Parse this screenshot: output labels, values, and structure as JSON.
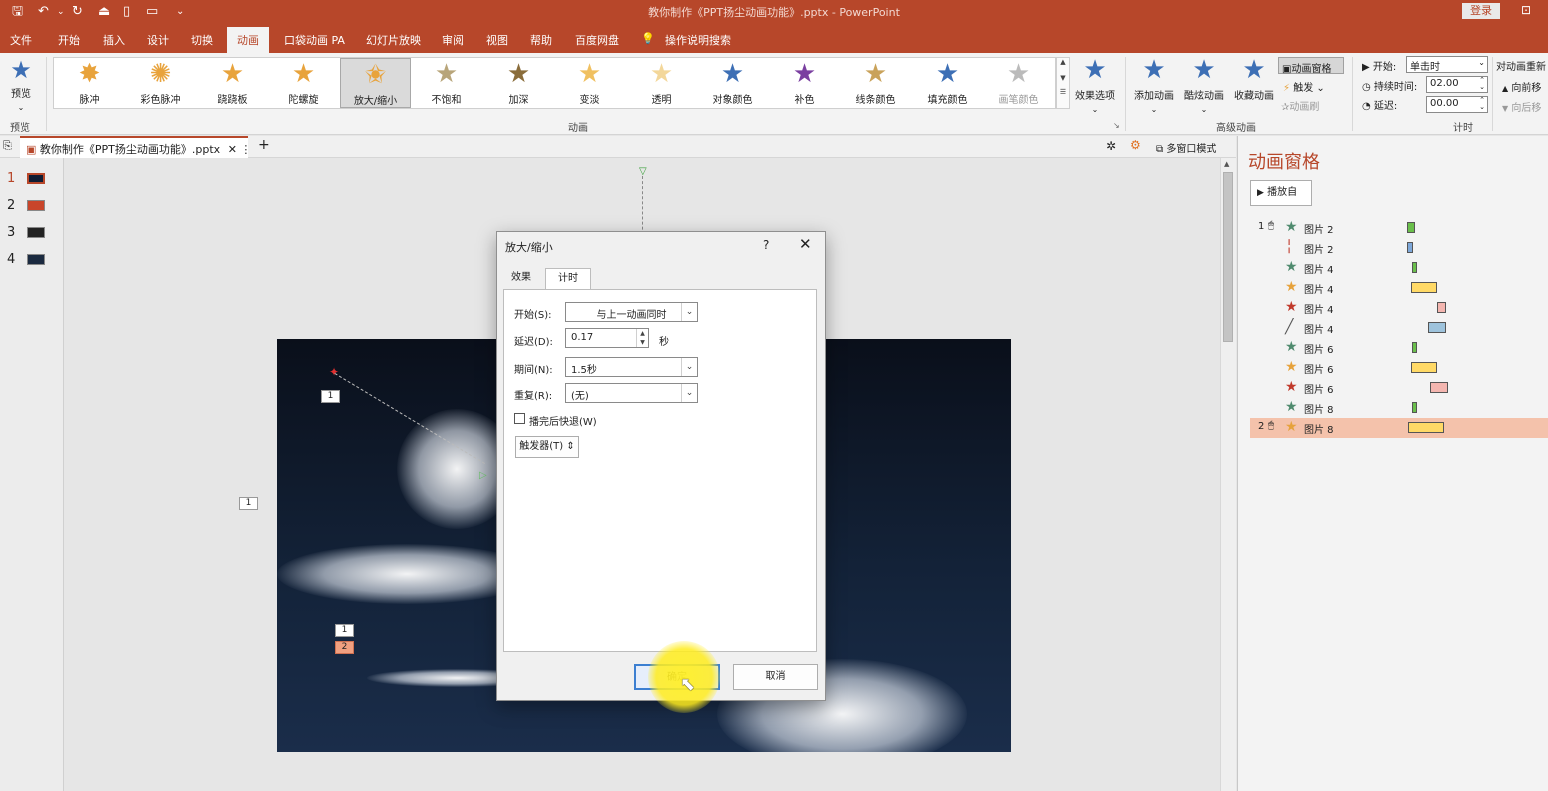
{
  "title_bar": {
    "title": "教你制作《PPT扬尘动画功能》.pptx  -  PowerPoint",
    "login": "登录"
  },
  "menu": [
    "文件",
    "开始",
    "插入",
    "设计",
    "切换",
    "动画",
    "口袋动画 PA",
    "幻灯片放映",
    "审阅",
    "视图",
    "帮助",
    "百度网盘",
    "操作说明搜索"
  ],
  "ribbon": {
    "preview_label": "预览",
    "preview_group": "预览",
    "gallery": [
      "脉冲",
      "彩色脉冲",
      "跷跷板",
      "陀螺旋",
      "放大/缩小",
      "不饱和",
      "加深",
      "变淡",
      "透明",
      "对象颜色",
      "补色",
      "线条颜色",
      "填充颜色",
      "画笔颜色"
    ],
    "gallery_selected": "放大/缩小",
    "effect_options": "效果选项",
    "animation_group": "动画",
    "add_animation": "添加动画",
    "cool_animation": "酷炫动画",
    "fav_animation": "收藏动画",
    "anim_pane_btn": "动画窗格",
    "trigger": "触发",
    "anim_brush": "动画刷",
    "advanced_group": "高级动画",
    "start_label": "开始:",
    "start_value": "单击时",
    "duration_label": "持续时间:",
    "duration_value": "02.00",
    "delay_label": "延迟:",
    "delay_value": "00.00",
    "timing_group": "计时",
    "reorder_label": "对动画重新",
    "move_earlier": "向前移",
    "move_later": "向后移"
  },
  "doc_tab": {
    "name": "教你制作《PPT扬尘动画功能》.pptx",
    "multi_window": "多窗口模式"
  },
  "thumbnails": [
    "1",
    "2",
    "3",
    "4"
  ],
  "slide_tags": [
    "1",
    "1",
    "1",
    "2"
  ],
  "dialog": {
    "title": "放大/缩小",
    "help": "?",
    "tabs": [
      "效果",
      "计时"
    ],
    "start_label": "开始(S):",
    "start_value": "与上一动画同时",
    "delay_label": "延迟(D):",
    "delay_value": "0.17",
    "delay_unit": "秒",
    "period_label": "期间(N):",
    "period_value": "1.5秒",
    "repeat_label": "重复(R):",
    "repeat_value": "(无)",
    "rewind_label": "播完后快退(W)",
    "trigger_label": "触发器(T)",
    "ok": "确定",
    "cancel": "取消"
  },
  "anim_pane": {
    "title": "动画窗格",
    "play_from": "播放自",
    "rows": [
      {
        "num": "1",
        "mouse": true,
        "icon": "★",
        "color": "#4f8a6e",
        "name": "图片 2",
        "bar_color": "#6abf4b"
      },
      {
        "num": "",
        "mouse": false,
        "icon": "╎",
        "color": "#c0392b",
        "name": "图片 2",
        "bar_color": "#7da7d9"
      },
      {
        "num": "",
        "mouse": false,
        "icon": "★",
        "color": "#4f8a6e",
        "name": "图片 4",
        "bar_color": "#6abf4b"
      },
      {
        "num": "",
        "mouse": false,
        "icon": "★",
        "color": "#e6a23c",
        "name": "图片 4",
        "bar_color": "#ffd966"
      },
      {
        "num": "",
        "mouse": false,
        "icon": "★",
        "color": "#c0392b",
        "name": "图片 4",
        "bar_color": "#f4b6b0"
      },
      {
        "num": "",
        "mouse": false,
        "icon": "╱",
        "color": "#555555",
        "name": "图片 4",
        "bar_color": "#9ec3dc"
      },
      {
        "num": "",
        "mouse": false,
        "icon": "★",
        "color": "#4f8a6e",
        "name": "图片 6",
        "bar_color": "#6abf4b"
      },
      {
        "num": "",
        "mouse": false,
        "icon": "★",
        "color": "#e6a23c",
        "name": "图片 6",
        "bar_color": "#ffd966"
      },
      {
        "num": "",
        "mouse": false,
        "icon": "★",
        "color": "#c0392b",
        "name": "图片 6",
        "bar_color": "#f4b6b0"
      },
      {
        "num": "",
        "mouse": false,
        "icon": "★",
        "color": "#4f8a6e",
        "name": "图片 8",
        "bar_color": "#6abf4b"
      },
      {
        "num": "2",
        "mouse": true,
        "icon": "★",
        "color": "#e6a23c",
        "name": "图片 8",
        "bar_color": "#ffd966",
        "selected": true
      }
    ]
  },
  "colors": {
    "accent": "#b7472a",
    "selected_row": "#f4c2ab",
    "dialog_bg": "#f0f0f0"
  }
}
